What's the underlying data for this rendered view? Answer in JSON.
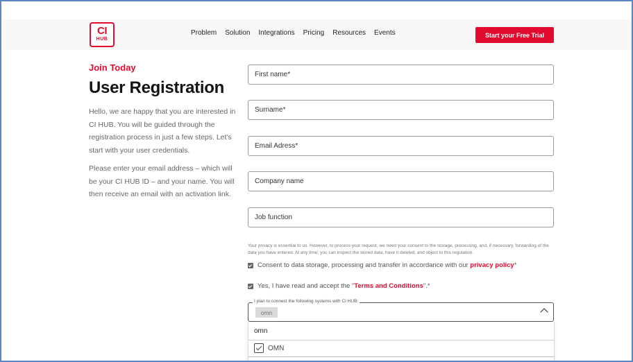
{
  "brand": {
    "logo_top": "CI",
    "logo_bottom": "HUB",
    "accent_color": "#e30a2f"
  },
  "nav": {
    "items": [
      "Problem",
      "Solution",
      "Integrations",
      "Pricing",
      "Resources",
      "Events"
    ]
  },
  "header": {
    "cta_label": "Start your Free Trial"
  },
  "intro": {
    "kicker": "Join Today",
    "title": "User Registration",
    "paragraph1": "Hello, we are happy that you are interested in CI HUB. You will be guided through the registration process in just a few steps. Let's start with your user credentials.",
    "paragraph2": "Please enter your email address – which will be your CI HUB ID –  and your name. You will then receive an email with an activation link."
  },
  "form": {
    "first_name_placeholder": "First name*",
    "surname_placeholder": "Surname*",
    "email_placeholder": "Email Adress*",
    "company_placeholder": "Company name",
    "job_placeholder": "Job function",
    "privacy_text": "Your privacy is essential to us. However, to process your request, we need your consent to the storage, processing, and, if necessary, forwarding of the data you have entered. At any time, you can inspect the stored data, have it deleted, and object to this regulation.",
    "consent_text": "Consent to data storage, processing and transfer in accordance with our ",
    "consent_link": "privacy policy",
    "consent_suffix": "*",
    "terms_text": "Yes, I have read and accept the \"",
    "terms_link": "Terms and Conditions",
    "terms_suffix": "\".*",
    "systems_legend": "I plan to connect the following systems with CI HUB:",
    "selected_chip": "omn",
    "search_value": "omn",
    "option_label": "OMN"
  }
}
